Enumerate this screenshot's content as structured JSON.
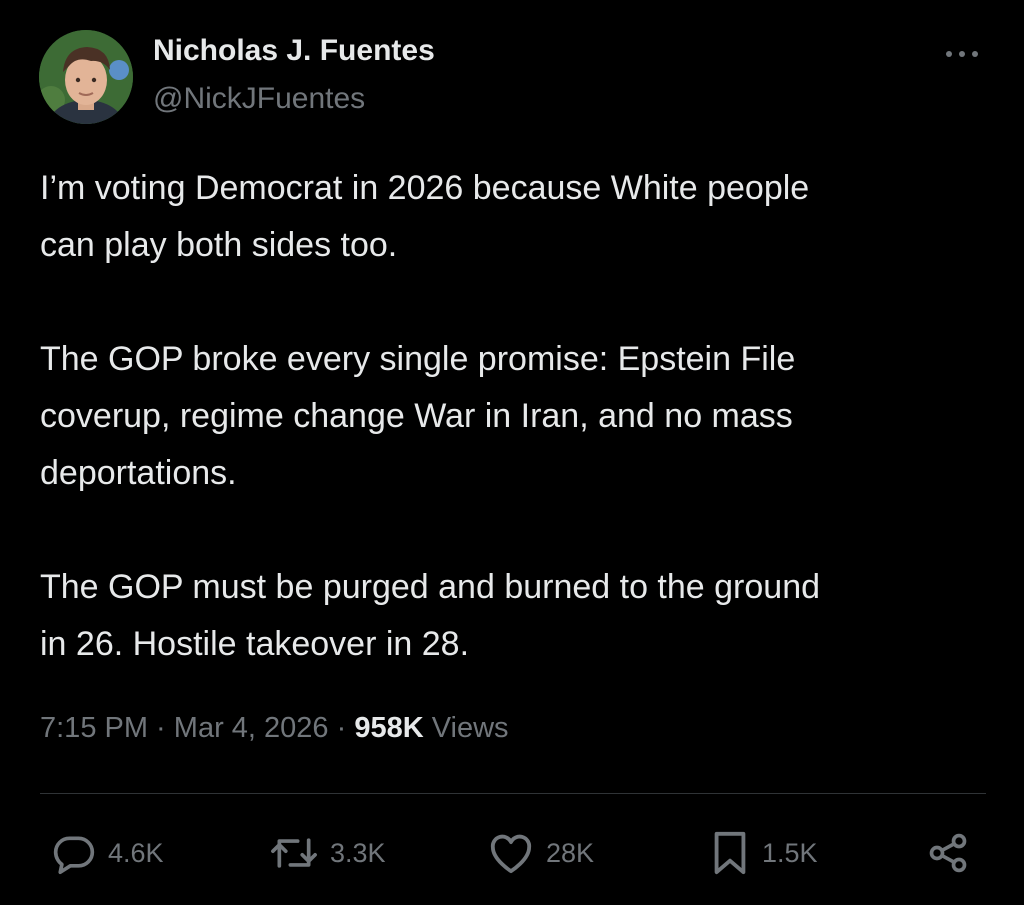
{
  "tweet": {
    "author": {
      "name": "Nicholas J. Fuentes",
      "handle": "@NickJFuentes"
    },
    "paragraphs": [
      "I’m voting Democrat in 2026 because White people\ncan play both sides too.",
      "The GOP broke every single promise: Epstein File\ncoverup, regime change War in Iran, and no mass\ndeportations.",
      "The GOP must be purged and burned to the ground\nin 26. Hostile takeover in 28."
    ],
    "meta": {
      "time": "7:15 PM",
      "separator": " · ",
      "date": "Mar 4, 2026",
      "views_count": "958K",
      "views_label": " Views"
    },
    "actions": {
      "replies": "4.6K",
      "reposts": "3.3K",
      "likes": "28K",
      "bookmarks": "1.5K"
    },
    "icons": {
      "more": "more-horizontal-icon",
      "reply": "reply-icon",
      "repost": "repost-icon",
      "like": "heart-icon",
      "bookmark": "bookmark-icon",
      "share": "share-icon"
    },
    "colors": {
      "background": "#000000",
      "primary_text": "#e7e9ea",
      "secondary_text": "#71767b",
      "divider": "#2f3336"
    }
  }
}
